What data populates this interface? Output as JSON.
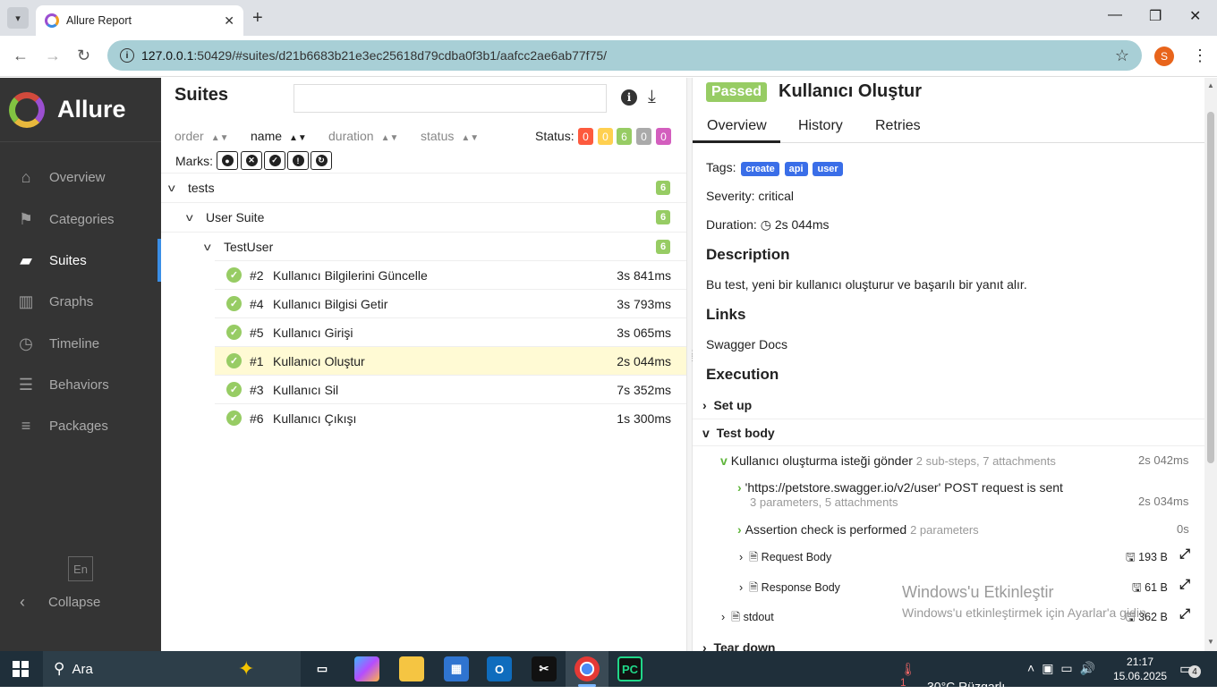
{
  "browser": {
    "tab_title": "Allure Report",
    "url_host": "127.0.0.1",
    "url_rest": ":50429/#suites/d21b6683b21e3ec25618d79cdba0f3b1/aafcc2ae6ab77f75/",
    "profile_initial": "S"
  },
  "sidebar": {
    "brand": "Allure",
    "items": [
      {
        "label": "Overview",
        "icon": "home-icon"
      },
      {
        "label": "Categories",
        "icon": "flag-icon"
      },
      {
        "label": "Suites",
        "icon": "briefcase-icon"
      },
      {
        "label": "Graphs",
        "icon": "bar-chart-icon"
      },
      {
        "label": "Timeline",
        "icon": "clock-icon"
      },
      {
        "label": "Behaviors",
        "icon": "list-icon"
      },
      {
        "label": "Packages",
        "icon": "align-left-icon"
      }
    ],
    "active": "Suites",
    "language": "En",
    "collapse": "Collapse"
  },
  "suites": {
    "title": "Suites",
    "search_placeholder": "",
    "sort": {
      "order": "order",
      "name": "name",
      "duration": "duration",
      "status": "status"
    },
    "status_label": "Status:",
    "status_counts": [
      {
        "value": "0",
        "color": "#fd5a3e"
      },
      {
        "value": "0",
        "color": "#ffd050"
      },
      {
        "value": "6",
        "color": "#97cc64"
      },
      {
        "value": "0",
        "color": "#aaaaaa"
      },
      {
        "value": "0",
        "color": "#d35ebe"
      }
    ],
    "marks_label": "Marks:",
    "tree": [
      {
        "label": "tests",
        "count": "6"
      },
      {
        "label": "User Suite",
        "count": "6"
      },
      {
        "label": "TestUser",
        "count": "6"
      }
    ],
    "tests": [
      {
        "num": "#2",
        "name": "Kullanıcı Bilgilerini Güncelle",
        "duration": "3s 841ms"
      },
      {
        "num": "#4",
        "name": "Kullanıcı Bilgisi Getir",
        "duration": "3s 793ms"
      },
      {
        "num": "#5",
        "name": "Kullanıcı Girişi",
        "duration": "3s 065ms"
      },
      {
        "num": "#1",
        "name": "Kullanıcı Oluştur",
        "duration": "2s 044ms"
      },
      {
        "num": "#3",
        "name": "Kullanıcı Sil",
        "duration": "7s 352ms"
      },
      {
        "num": "#6",
        "name": "Kullanıcı Çıkışı",
        "duration": "1s 300ms"
      }
    ]
  },
  "detail": {
    "status": "Passed",
    "title": "Kullanıcı Oluştur",
    "tabs": [
      "Overview",
      "History",
      "Retries"
    ],
    "tags_label": "Tags:",
    "tags": [
      "create",
      "api",
      "user"
    ],
    "severity": "Severity: critical",
    "duration_label": "Duration:",
    "duration": "2s 044ms",
    "description_head": "Description",
    "description": "Bu test, yeni bir kullanıcı oluşturur ve başarılı bir yanıt alır.",
    "links_head": "Links",
    "link": "Swagger Docs",
    "execution_head": "Execution",
    "setup": "Set up",
    "test_body": "Test body",
    "step1": {
      "name": "Kullanıcı oluşturma isteği gönder",
      "meta": "2 sub-steps, 7 attachments",
      "duration": "2s 042ms"
    },
    "step2": {
      "name": "'https://petstore.swagger.io/v2/user' POST request is sent",
      "meta": "3 parameters, 5 attachments",
      "duration": "2s 034ms"
    },
    "step3": {
      "name": "Assertion check is performed",
      "meta": "2 parameters",
      "duration": "0s"
    },
    "attachments": [
      {
        "name": "Request Body",
        "size": "193 B"
      },
      {
        "name": "Response Body",
        "size": "61 B"
      },
      {
        "name": "stdout",
        "size": "362 B"
      }
    ],
    "teardown": "Tear down"
  },
  "watermark": {
    "line1": "Windows'u Etkinleştir",
    "line2": "Windows'u etkinleştirmek için Ayarlar'a gidin."
  },
  "taskbar": {
    "search": "Ara",
    "weather": "30°C  Rüzgarlı",
    "time": "21:17",
    "date": "15.06.2025",
    "notifications": "4",
    "weather_badge": "1"
  }
}
